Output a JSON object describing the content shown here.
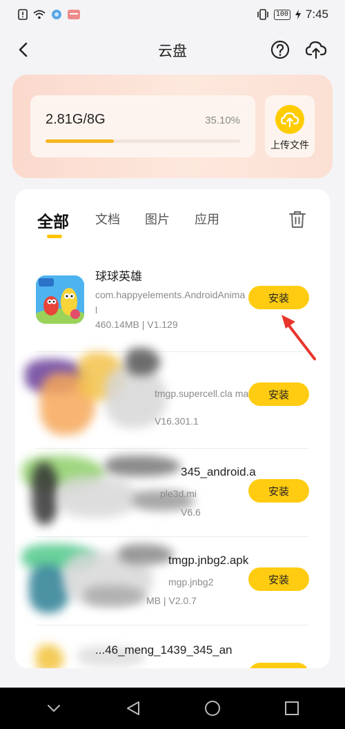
{
  "status_bar": {
    "battery": "100",
    "time": "7:45"
  },
  "header": {
    "title": "云盘"
  },
  "storage": {
    "usage": "2.81G/8G",
    "percent": "35.10%",
    "fill_fraction": 0.351,
    "upload_label": "上传文件"
  },
  "tabs": [
    {
      "label": "全部",
      "active": true
    },
    {
      "label": "文档",
      "active": false
    },
    {
      "label": "图片",
      "active": false
    },
    {
      "label": "应用",
      "active": false
    }
  ],
  "files": [
    {
      "name": "球球英雄",
      "package": "com.happyelements.AndroidAnimal",
      "meta": "460.14MB | V1.129",
      "button": "安装"
    },
    {
      "name": "",
      "package": "tmgp.supercell.cla\nmal",
      "meta": "V16.301.1",
      "button": "安装"
    },
    {
      "name": "345_android.a",
      "package": "ple3d.mi",
      "meta": "V6.6",
      "button": "安装"
    },
    {
      "name": "tmgp.jnbg2.apk",
      "package": "mgp.jnbg2",
      "meta": "MB | V2.0.7",
      "button": "安装"
    },
    {
      "name": "...46_meng_1439_345_an",
      "package": "",
      "meta": "",
      "button": "安装"
    }
  ],
  "icons": {
    "back": "chevron-left-icon",
    "help": "question-circle-icon",
    "cloud": "cloud-upload-icon",
    "trash": "trash-icon"
  },
  "colors": {
    "accent": "#ffcc11",
    "progress": "#f5b71c",
    "storage_bg": "#fbd9cd",
    "arrow": "#e8352b"
  }
}
